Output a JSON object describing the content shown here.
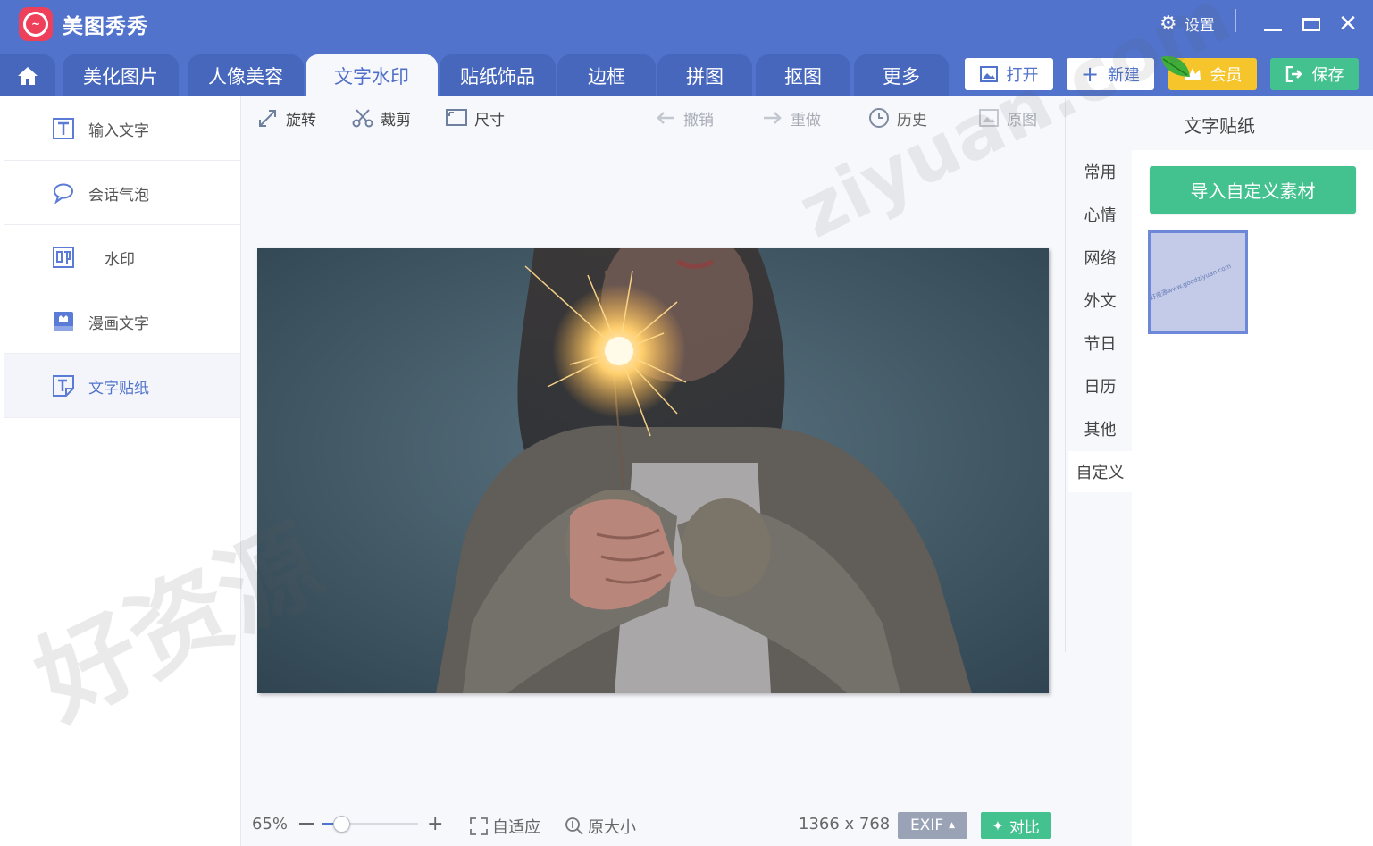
{
  "app": {
    "title": "美图秀秀"
  },
  "titlebar": {
    "settings_label": "设置"
  },
  "tabs": [
    {
      "label": "美化图片"
    },
    {
      "label": "人像美容"
    },
    {
      "label": "文字水印"
    },
    {
      "label": "贴纸饰品"
    },
    {
      "label": "边框"
    },
    {
      "label": "拼图"
    },
    {
      "label": "抠图"
    },
    {
      "label": "更多"
    }
  ],
  "active_tab": "文字水印",
  "actions": {
    "open": "打开",
    "new": "新建",
    "vip": "会员",
    "save": "保存"
  },
  "left_menu": [
    {
      "label": "输入文字",
      "icon": "text-t-icon"
    },
    {
      "label": "会话气泡",
      "icon": "speech-bubble-icon"
    },
    {
      "label": "水印",
      "icon": "watermark-stamp-icon"
    },
    {
      "label": "漫画文字",
      "icon": "comic-text-icon"
    },
    {
      "label": "文字贴纸",
      "icon": "text-sticker-icon"
    }
  ],
  "active_left_item": "文字贴纸",
  "toolbar": {
    "rotate": "旋转",
    "crop": "裁剪",
    "size": "尺寸",
    "undo": "撤销",
    "redo": "重做",
    "history": "历史",
    "original": "原图"
  },
  "right_panel": {
    "title": "文字贴纸",
    "categories": [
      "常用",
      "心情",
      "网络",
      "外文",
      "节日",
      "日历",
      "其他",
      "自定义"
    ],
    "active_category": "自定义",
    "import_button": "导入自定义素材",
    "sticker_thumb_text": "好资源www.goodziyuan.com"
  },
  "bottom": {
    "zoom_percent": "65%",
    "zoom_level": 0.2,
    "fit_label": "自适应",
    "actual_size_label": "原大小",
    "dimensions": "1366 x 768",
    "exif_label": "EXIF",
    "compare_label": "对比"
  },
  "watermarks": [
    "好资源",
    "ziyuan.com"
  ],
  "colors": {
    "header_blue": "#5273cc",
    "tab_blue": "#4767bd",
    "accent_green": "#43c18f",
    "vip_yellow": "#f6c52c",
    "logo_red": "#ee3f5b"
  }
}
